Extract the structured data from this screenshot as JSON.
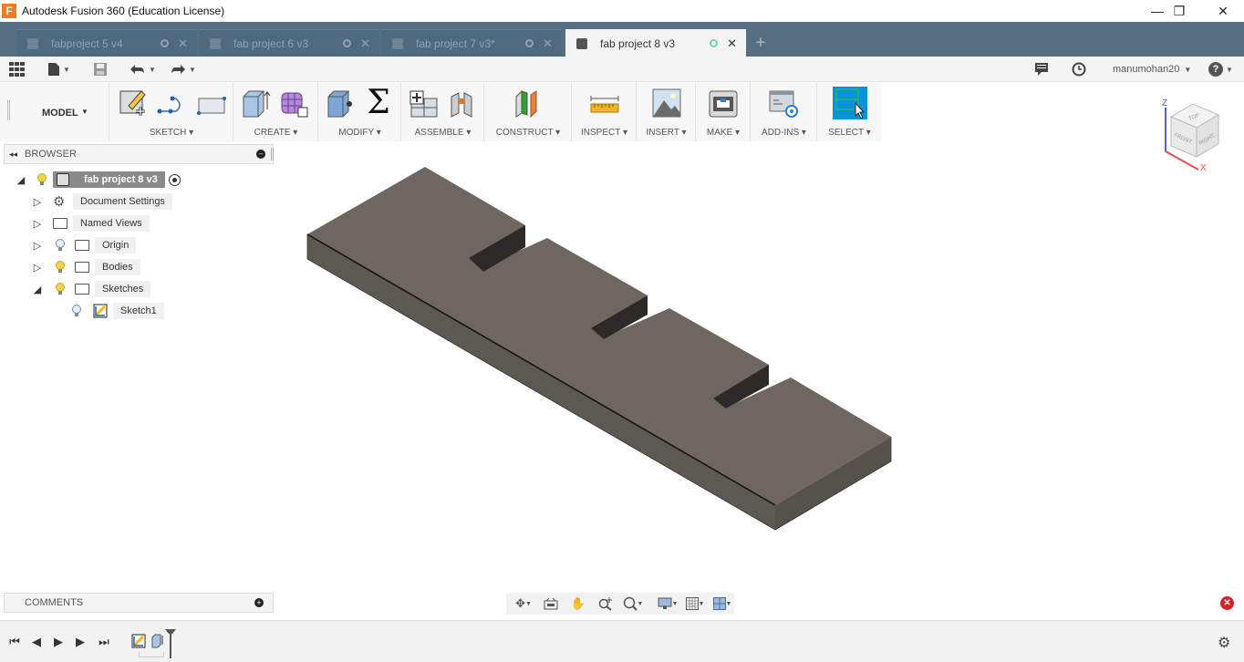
{
  "app": {
    "title": "Autodesk Fusion 360 (Education License)",
    "logo": "F"
  },
  "window_controls": {
    "minimize": "—",
    "restore": "❐",
    "close": "✕"
  },
  "tabs": [
    {
      "label": "fabproject 5 v4",
      "active": false
    },
    {
      "label": "fab project 6 v3",
      "active": false
    },
    {
      "label": "fab project 7 v3*",
      "active": false
    },
    {
      "label": "fab project 8 v3",
      "active": true
    }
  ],
  "new_tab": "+",
  "quick_access": {
    "user": "manumohan20",
    "help": "?"
  },
  "ribbon": {
    "workspace": "MODEL",
    "groups": [
      {
        "label": "SKETCH"
      },
      {
        "label": "CREATE"
      },
      {
        "label": "MODIFY"
      },
      {
        "label": "ASSEMBLE"
      },
      {
        "label": "CONSTRUCT"
      },
      {
        "label": "INSPECT"
      },
      {
        "label": "INSERT"
      },
      {
        "label": "MAKE"
      },
      {
        "label": "ADD-INS"
      },
      {
        "label": "SELECT"
      }
    ],
    "sigma": "Σ"
  },
  "browser": {
    "title": "BROWSER",
    "root": "fab project 8 v3",
    "items": [
      {
        "label": "Document Settings",
        "icon": "gear-icon"
      },
      {
        "label": "Named Views",
        "icon": "folder-icon"
      },
      {
        "label": "Origin",
        "icon": "folder-icon"
      },
      {
        "label": "Bodies",
        "icon": "folder-icon"
      },
      {
        "label": "Sketches",
        "icon": "folder-icon"
      },
      {
        "label": "Sketch1",
        "icon": "sketch-icon"
      }
    ]
  },
  "viewcube": {
    "top": "TOP",
    "front": "FRONT",
    "right": "RIGHT",
    "axis_z": "Z",
    "axis_x": "X"
  },
  "comments": {
    "title": "COMMENTS"
  },
  "colors": {
    "accent": "#0696d7",
    "tabbar": "#566e82",
    "body_top": "#6e665f",
    "body_side": "#58554f"
  }
}
